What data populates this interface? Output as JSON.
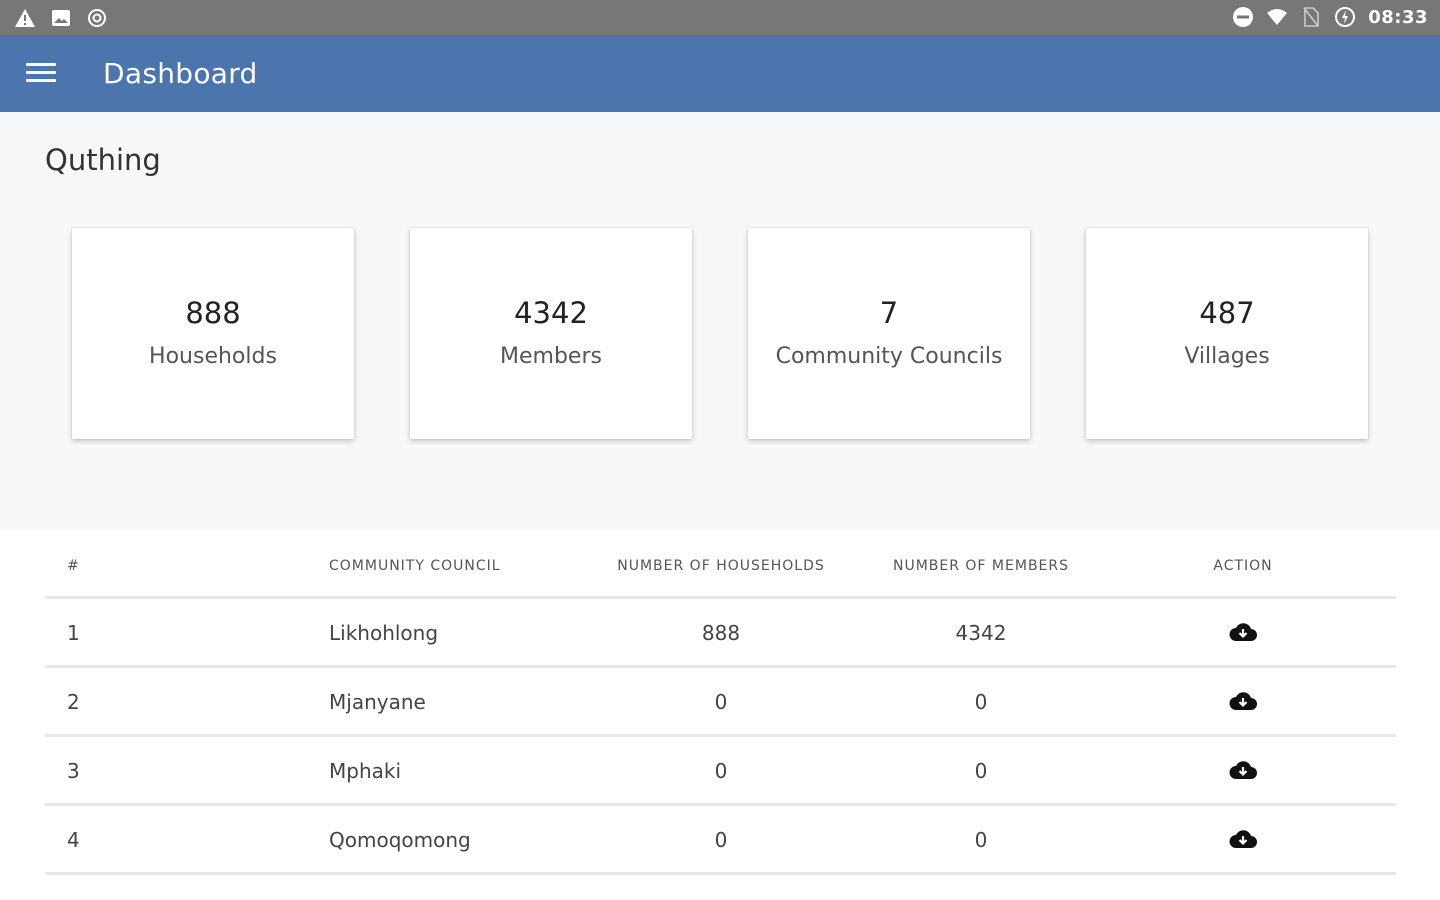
{
  "status_bar": {
    "left_icons": [
      "warning-icon",
      "image-icon",
      "sync-icon"
    ],
    "right_icons": [
      "do-not-disturb-icon",
      "wifi-icon",
      "no-sim-icon",
      "battery-icon"
    ],
    "time": "08:33"
  },
  "app_bar": {
    "menu_icon": "menu-icon",
    "title": "Dashboard",
    "color": "#4c74ad"
  },
  "district": "Quthing",
  "summary_cards": [
    {
      "value": "888",
      "label": "Households"
    },
    {
      "value": "4342",
      "label": "Members"
    },
    {
      "value": "7",
      "label": "Community Councils"
    },
    {
      "value": "487",
      "label": "Villages"
    }
  ],
  "table": {
    "headers": [
      "#",
      "Community Council",
      "Number of Households",
      "Number of Members",
      "Action"
    ],
    "rows": [
      {
        "num": "1",
        "council": "Likhohlong",
        "households": "888",
        "members": "4342",
        "action_icon": "cloud-download-icon"
      },
      {
        "num": "2",
        "council": "Mjanyane",
        "households": "0",
        "members": "0",
        "action_icon": "cloud-download-icon"
      },
      {
        "num": "3",
        "council": "Mphaki",
        "households": "0",
        "members": "0",
        "action_icon": "cloud-download-icon"
      },
      {
        "num": "4",
        "council": "Qomoqomong",
        "households": "0",
        "members": "0",
        "action_icon": "cloud-download-icon"
      }
    ]
  }
}
